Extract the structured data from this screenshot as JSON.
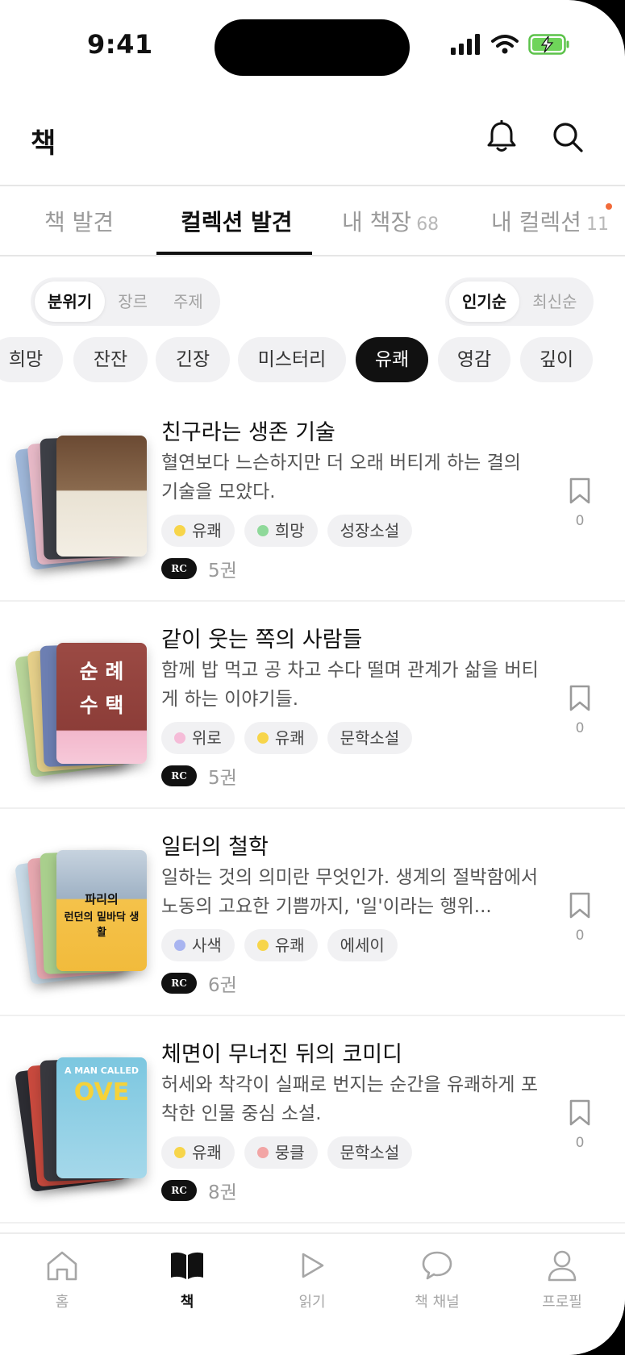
{
  "status_bar": {
    "time": "9:41"
  },
  "header": {
    "title": "책"
  },
  "tabs": [
    {
      "label": "책 발견",
      "count": ""
    },
    {
      "label": "컬렉션 발견",
      "count": ""
    },
    {
      "label": "내 책장",
      "count": "68"
    },
    {
      "label": "내 컬렉션",
      "count": "11"
    }
  ],
  "active_tab": "컬렉션 발견",
  "filter_segment": {
    "items": [
      "분위기",
      "장르",
      "주제"
    ],
    "selected": "분위기"
  },
  "sort_segment": {
    "items": [
      "인기순",
      "최신순"
    ],
    "selected": "인기순"
  },
  "mood_chips": {
    "items": [
      "희망",
      "잔잔",
      "긴장",
      "미스터리",
      "유쾌",
      "영감",
      "깊이"
    ],
    "selected": "유쾌"
  },
  "collections": [
    {
      "title": "친구라는 생존 기술",
      "description": "혈연보다 느슨하지만 더 오래 버티게 하는 결의 기술을 모았다.",
      "tags": [
        {
          "label": "유쾌",
          "dot_color": "#f7d54a"
        },
        {
          "label": "희망",
          "dot_color": "#8fd99a"
        },
        {
          "label": "성장소설",
          "dot_color": ""
        }
      ],
      "badge": "RC",
      "count": "5권",
      "bookmark_count": "0",
      "cover_text": [
        "",
        ""
      ]
    },
    {
      "title": "같이 웃는 쪽의 사람들",
      "description": "함께 밥 먹고 공 차고 수다 떨며 관계가 삶을 버티게 하는 이야기들.",
      "tags": [
        {
          "label": "위로",
          "dot_color": "#f5bcd8"
        },
        {
          "label": "유쾌",
          "dot_color": "#f7d54a"
        },
        {
          "label": "문학소설",
          "dot_color": ""
        }
      ],
      "badge": "RC",
      "count": "5권",
      "bookmark_count": "0",
      "cover_text": [
        "순 례",
        "수 택"
      ]
    },
    {
      "title": "일터의 철학",
      "description": "일하는 것의 의미란 무엇인가. 생계의 절박함에서 노동의 고요한 기쁨까지, '일'이라는 행위...",
      "tags": [
        {
          "label": "사색",
          "dot_color": "#a8b4f0"
        },
        {
          "label": "유쾌",
          "dot_color": "#f7d54a"
        },
        {
          "label": "에세이",
          "dot_color": ""
        }
      ],
      "badge": "RC",
      "count": "6권",
      "bookmark_count": "0",
      "cover_text": [
        "파리의",
        "런던의 밑바닥 생활"
      ]
    },
    {
      "title": "체면이 무너진 뒤의 코미디",
      "description": "허세와 착각이 실패로 번지는 순간을 유쾌하게 포착한 인물 중심 소설.",
      "tags": [
        {
          "label": "유쾌",
          "dot_color": "#f7d54a"
        },
        {
          "label": "뭉클",
          "dot_color": "#f2a5a5"
        },
        {
          "label": "문학소설",
          "dot_color": ""
        }
      ],
      "badge": "RC",
      "count": "8권",
      "bookmark_count": "0",
      "cover_text": [
        "A MAN CALLED",
        "OVE"
      ]
    }
  ],
  "bottom_nav": [
    {
      "label": "홈",
      "icon": "home-icon"
    },
    {
      "label": "책",
      "icon": "book-icon"
    },
    {
      "label": "읽기",
      "icon": "play-icon"
    },
    {
      "label": "책 채널",
      "icon": "chat-icon"
    },
    {
      "label": "프로필",
      "icon": "profile-icon"
    }
  ],
  "bottom_nav_active": "책",
  "colors": {
    "accent_dot": "#f26b3a",
    "active": "#111111"
  }
}
